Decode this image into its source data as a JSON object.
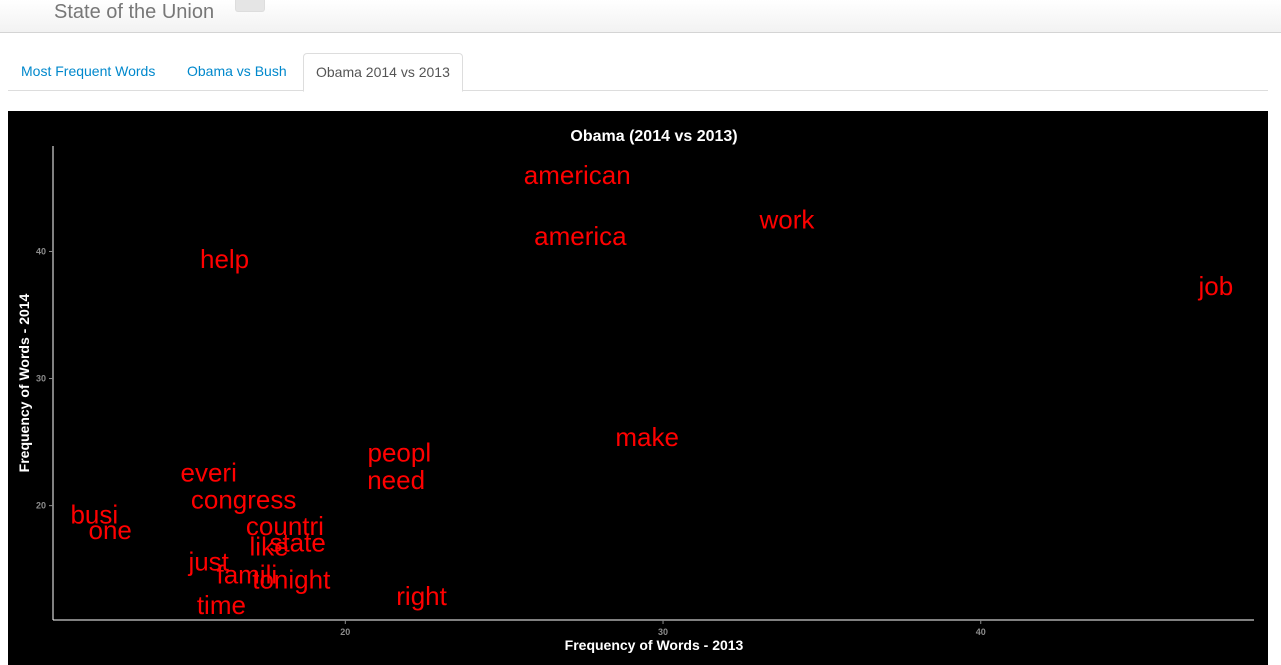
{
  "navbar": {
    "brand": "State of the Union"
  },
  "tabs": [
    {
      "label": "Most Frequent Words",
      "active": false
    },
    {
      "label": "Obama vs Bush",
      "active": false
    },
    {
      "label": "Obama 2014 vs 2013",
      "active": true
    }
  ],
  "colors": {
    "plot_background": "#000000",
    "word_color": "#ff0000",
    "text_color": "#ffffff",
    "tick_color": "#8c8c8c",
    "tab_link": "#0088cc"
  },
  "chart_data": {
    "type": "scatter",
    "title": "Obama (2014 vs 2013)",
    "xlabel": "Frequency of Words - 2013",
    "ylabel": "Frequency of Words - 2014",
    "xlim": [
      10.8,
      48.6
    ],
    "ylim": [
      11,
      48.3
    ],
    "xticks": [
      20,
      30,
      40
    ],
    "yticks": [
      20,
      30,
      40
    ],
    "grid": false,
    "legend": "none",
    "points": [
      {
        "label": "american",
        "x": 27.3,
        "y": 46
      },
      {
        "label": "work",
        "x": 33.9,
        "y": 42.5
      },
      {
        "label": "america",
        "x": 27.4,
        "y": 41.2
      },
      {
        "label": "help",
        "x": 16.2,
        "y": 39.4
      },
      {
        "label": "job",
        "x": 47.4,
        "y": 37.3
      },
      {
        "label": "make",
        "x": 29.5,
        "y": 25.4
      },
      {
        "label": "peopl",
        "x": 21.7,
        "y": 24.2
      },
      {
        "label": "need",
        "x": 21.6,
        "y": 22
      },
      {
        "label": "everi",
        "x": 15.7,
        "y": 22.6
      },
      {
        "label": "congress",
        "x": 16.8,
        "y": 20.5
      },
      {
        "label": "busi",
        "x": 12.1,
        "y": 19.3
      },
      {
        "label": "one",
        "x": 12.6,
        "y": 18.1
      },
      {
        "label": "countri",
        "x": 18.1,
        "y": 18.4
      },
      {
        "label": "state",
        "x": 18.5,
        "y": 17.1
      },
      {
        "label": "like",
        "x": 17.6,
        "y": 16.8
      },
      {
        "label": "just",
        "x": 15.7,
        "y": 15.6
      },
      {
        "label": "famili",
        "x": 16.9,
        "y": 14.6
      },
      {
        "label": "tonight",
        "x": 18.3,
        "y": 14.2
      },
      {
        "label": "right",
        "x": 22.4,
        "y": 12.9
      },
      {
        "label": "time",
        "x": 16.1,
        "y": 12.2
      }
    ]
  }
}
